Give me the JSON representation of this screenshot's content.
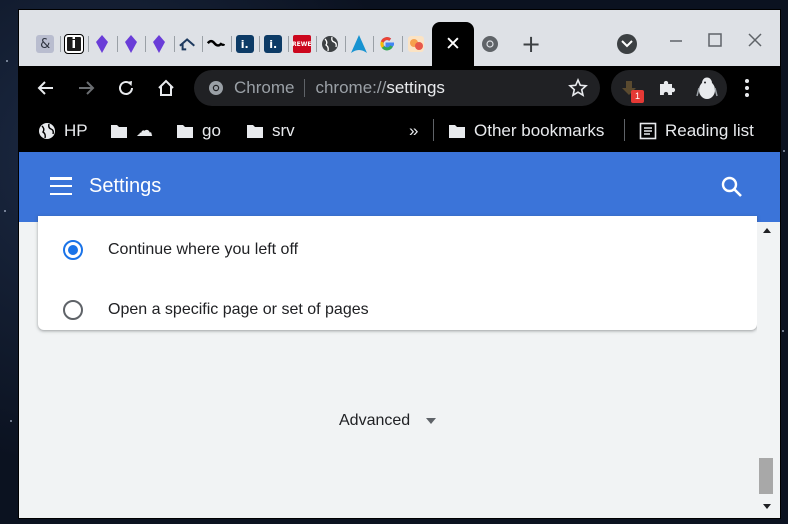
{
  "tabs": [
    {
      "icon": "bookmark-ampersand-icon",
      "glyph": "&",
      "color": "#7a7f95"
    },
    {
      "icon": "info-i-icon",
      "glyph": "i",
      "color": "#1b1b1b"
    },
    {
      "icon": "purple-gem-icon",
      "glyph": "",
      "color": "#6a3dd8"
    },
    {
      "icon": "purple-gem-icon",
      "glyph": "",
      "color": "#6a3dd8"
    },
    {
      "icon": "purple-gem-icon",
      "glyph": "",
      "color": "#6a3dd8"
    },
    {
      "icon": "house-cloud-icon",
      "glyph": "",
      "color": "#1e3a5f"
    },
    {
      "icon": "wave-line-icon",
      "glyph": "",
      "color": "#000000"
    },
    {
      "icon": "il-logo-icon",
      "glyph": "i.",
      "color": "#0d3b66"
    },
    {
      "icon": "il-logo-icon",
      "glyph": "i.",
      "color": "#0d3b66"
    },
    {
      "icon": "rewe-logo-icon",
      "glyph": "REWE",
      "color": "#cc071e"
    },
    {
      "icon": "globe-icon",
      "glyph": "",
      "color": "#3c4043"
    },
    {
      "icon": "arch-a-icon",
      "glyph": "",
      "color": "#1793d1"
    },
    {
      "icon": "google-g-icon",
      "glyph": "G",
      "color": "#ffffff"
    },
    {
      "icon": "fruit-basket-icon",
      "glyph": "",
      "color": "#f6a04d"
    }
  ],
  "active_tab": {
    "close_glyph": "✕"
  },
  "new_tab_glyph": "+",
  "toolbar": {
    "omnibox_chip_label": "Chrome",
    "url_scheme": "chrome://",
    "url_host": "settings",
    "extension_badge": "1"
  },
  "bookmarks": {
    "items": [
      {
        "label": "HP",
        "icon": "globe-icon"
      },
      {
        "label": "☁",
        "icon": "folder-icon"
      },
      {
        "label": "go",
        "icon": "folder-icon"
      },
      {
        "label": "srv",
        "icon": "folder-icon"
      }
    ],
    "overflow_label": "»",
    "other_bookmarks_label": "Other bookmarks",
    "reading_list_label": "Reading list"
  },
  "settings": {
    "title": "Settings",
    "startup_options": [
      {
        "label": "Continue where you left off",
        "selected": true
      },
      {
        "label": "Open a specific page or set of pages",
        "selected": false
      }
    ],
    "advanced_label": "Advanced"
  },
  "colors": {
    "accent": "#3b74d9",
    "radio_selected": "#1a73e8",
    "toolbar_bg": "#000000",
    "tabstrip_bg": "#dee1e6"
  }
}
